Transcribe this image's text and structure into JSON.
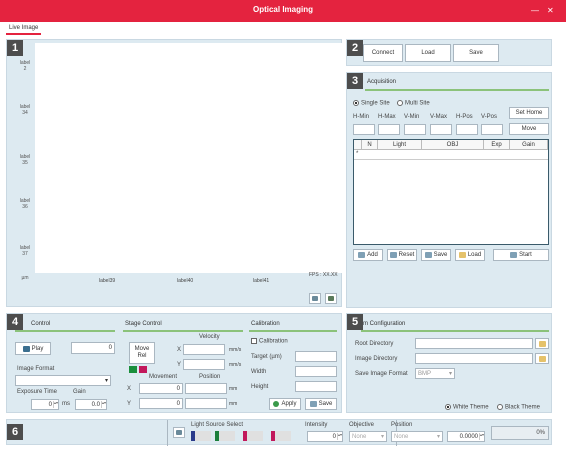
{
  "window": {
    "title": "Optical Imaging",
    "minimize": "—",
    "close": "✕"
  },
  "tabs": [
    {
      "label": "Live Image"
    }
  ],
  "panels": {
    "p1": "1",
    "p2": "2",
    "p3": "3",
    "p4": "4",
    "p5": "5",
    "p6": "6"
  },
  "live": {
    "y_labels": [
      "label\n2",
      "label\n34",
      "label\n35",
      "label\n36",
      "label\n37"
    ],
    "y_unit": "µm",
    "x_labels": [
      "label39",
      "label40",
      "label41"
    ],
    "fps": "FPS : XX.XX"
  },
  "connection": {
    "connect": "Connect",
    "load": "Load",
    "save": "Save"
  },
  "acquisition": {
    "title": "Acquisition",
    "single_site": "Single Site",
    "multi_site": "Multi Site",
    "set_home": "Set Home",
    "move": "Move",
    "columns_pos": [
      "H-Min",
      "H-Max",
      "V-Min",
      "V-Max",
      "H-Pos",
      "V-Pos"
    ],
    "table_headers": [
      "N",
      "Light",
      "OBJ",
      "Exp",
      "Gain"
    ],
    "row_marker": "*",
    "add": "Add",
    "reset": "Reset",
    "save": "Save",
    "load": "Load",
    "start": "Start"
  },
  "control": {
    "title": "Control",
    "play": "Play",
    "counter": "0",
    "image_format": "Image Format",
    "exposure_time": "Exposure Time",
    "gain": "Gain",
    "exposure_value": "0",
    "exposure_unit": "ms",
    "gain_value": "0.0"
  },
  "stage": {
    "title": "Stage Control",
    "velocity": "Velocity",
    "move_rel": "Move\nRel",
    "x": "X",
    "y": "Y",
    "unit_velocity": "mm/s",
    "movement": "Movement",
    "position": "Position",
    "mov_x": "0",
    "mov_y": "0",
    "unit_mm": "mm"
  },
  "calibration": {
    "title": "Calibration",
    "calibration": "Calibration",
    "target": "Target (µm)",
    "width": "Width",
    "height": "Height",
    "apply": "Apply",
    "save": "Save"
  },
  "system": {
    "title": "System Configuration",
    "title_visible": "m Configuration",
    "root_dir": "Root Directory",
    "image_dir": "Image Directory",
    "save_format": "Save Image Format",
    "save_format_value": "BMP",
    "white_theme": "White Theme",
    "black_theme": "Black Theme"
  },
  "statusbar": {
    "light_source": "Light Source Select",
    "intensity": "Intensity",
    "intensity_value": "0",
    "objective": "Objective",
    "objective_value": "None",
    "position": "Position",
    "position_value": "None",
    "position_num": "0.0000",
    "progress_text": "0%",
    "progress": 0
  },
  "colors": {
    "accent": "#e4233f",
    "panel": "#ddeaf1",
    "green": "#1a8f3c",
    "magenta": "#c2185b"
  }
}
